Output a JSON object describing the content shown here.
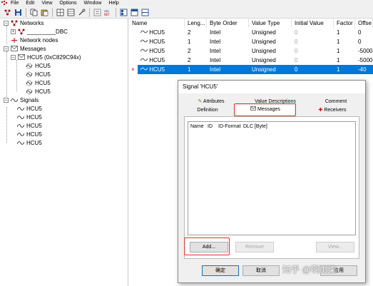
{
  "menu": {
    "items": [
      "File",
      "Edit",
      "View",
      "Options",
      "Window",
      "Help"
    ]
  },
  "toolbar": {
    "icons": [
      "new-db-icon",
      "save-icon",
      "copy-icon",
      "paste-icon",
      "grid-icon",
      "table-icon",
      "wrench-icon",
      "list-icon",
      "signal-icon",
      "list-view-icon",
      "db-icon",
      "window-icon",
      "message-icon",
      "signal-list-icon"
    ]
  },
  "tree": {
    "networks_label": "Networks",
    "db_label": "_________DBC",
    "network_nodes_label": "Network nodes",
    "messages_label": "Messages",
    "message_label": "HCU5 (0xC829C94x)",
    "message_signals": [
      "HCU5",
      "HCU5",
      "HCU5",
      "HCU5"
    ],
    "signals_label": "Signals",
    "signals": [
      "HCU5",
      "HCU5",
      "HCU5",
      "HCU5",
      "HCU5"
    ]
  },
  "grid": {
    "headers": [
      "Name",
      "Leng...",
      "Byte Order",
      "Value Type",
      "Initial Value",
      "Factor",
      "Offse"
    ],
    "rows": [
      [
        "HCU5",
        "2",
        "Intel",
        "Unsigned",
        "0",
        "1",
        "0"
      ],
      [
        "HCU5",
        "1",
        "Intel",
        "Unsigned",
        "0",
        "1",
        "0"
      ],
      [
        "HCU5",
        "2",
        "Intel",
        "Unsigned",
        "0",
        "1",
        "-5000"
      ],
      [
        "HCU5",
        "2",
        "Intel",
        "Unsigned",
        "0",
        "1",
        "-5000"
      ],
      [
        "HCU5",
        "1",
        "Intel",
        "Unsigned",
        "0",
        "1",
        "-40"
      ]
    ],
    "error_mark": "×"
  },
  "dialog": {
    "title": "Signal 'HCU5'",
    "tabs_back": [
      "Attributes",
      "Value Descriptions",
      "Comment"
    ],
    "tabs_front": [
      "Definition",
      "Messages",
      "Receivers"
    ],
    "list_headers": [
      "Name",
      "ID",
      "ID-Format",
      "DLC [Byte]"
    ],
    "add_label": "Add...",
    "remove_label": "Remove",
    "view_label": "View...",
    "ok_label": "确定",
    "cancel_label": "取消",
    "apply_label": "应用"
  },
  "watermark": "知乎 @啊雨柒",
  "colors": {
    "selection": "#0078d7",
    "highlight_box": "#d8322b",
    "db_red": "#c00000",
    "disabled_text": "#a7a7a7"
  }
}
